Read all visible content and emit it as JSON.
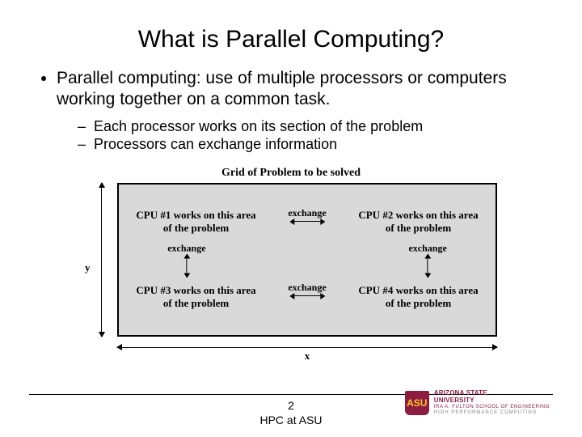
{
  "title": "What is Parallel Computing?",
  "bullet_main": "Parallel computing: use of multiple processors or computers working together on a common task.",
  "sub1": "Each processor works on its section of the problem",
  "sub2": "Processors can exchange information",
  "diagram": {
    "caption": "Grid of Problem to be solved",
    "cpu1_l1": "CPU #1 works on this area",
    "cpu1_l2": "of the problem",
    "cpu2_l1": "CPU #2 works on this area",
    "cpu2_l2": "of the problem",
    "cpu3_l1": "CPU #3 works on this area",
    "cpu3_l2": "of the problem",
    "cpu4_l1": "CPU #4 works on this area",
    "cpu4_l2": "of the problem",
    "exchange": "exchange",
    "xlabel": "x",
    "ylabel": "y"
  },
  "footer": {
    "page": "2",
    "course": "HPC at ASU"
  },
  "logo": {
    "shield": "ASU",
    "line1": "ARIZONA STATE",
    "line2": "UNIVERSITY",
    "line3": "IRA A. FULTON SCHOOL OF ENGINEERING",
    "line4": "HIGH PERFORMANCE COMPUTING"
  }
}
